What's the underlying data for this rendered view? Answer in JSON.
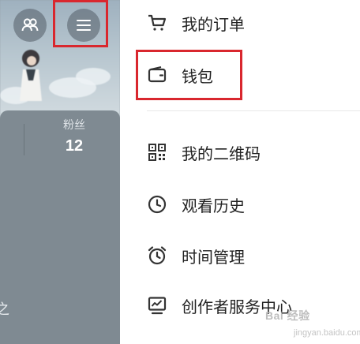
{
  "profile": {
    "fans_label": "粉丝",
    "fans_value": "12",
    "edge_text": "之"
  },
  "top_buttons": {
    "friends_icon": "people-icon",
    "menu_icon": "hamburger-menu-icon"
  },
  "menu": {
    "items": [
      {
        "label": "我的订单",
        "icon": "cart-icon"
      },
      {
        "label": "钱包",
        "icon": "wallet-icon"
      },
      {
        "label": "我的二维码",
        "icon": "qr-code-icon"
      },
      {
        "label": "观看历史",
        "icon": "clock-icon"
      },
      {
        "label": "时间管理",
        "icon": "alarm-clock-icon"
      },
      {
        "label": "创作者服务中心",
        "icon": "chart-monitor-icon"
      }
    ]
  },
  "watermark": {
    "brand": "Bai 经验",
    "url": "jingyan.baidu.com"
  },
  "colors": {
    "highlight": "#d9272e",
    "text": "#222222",
    "icon": "#333333"
  }
}
